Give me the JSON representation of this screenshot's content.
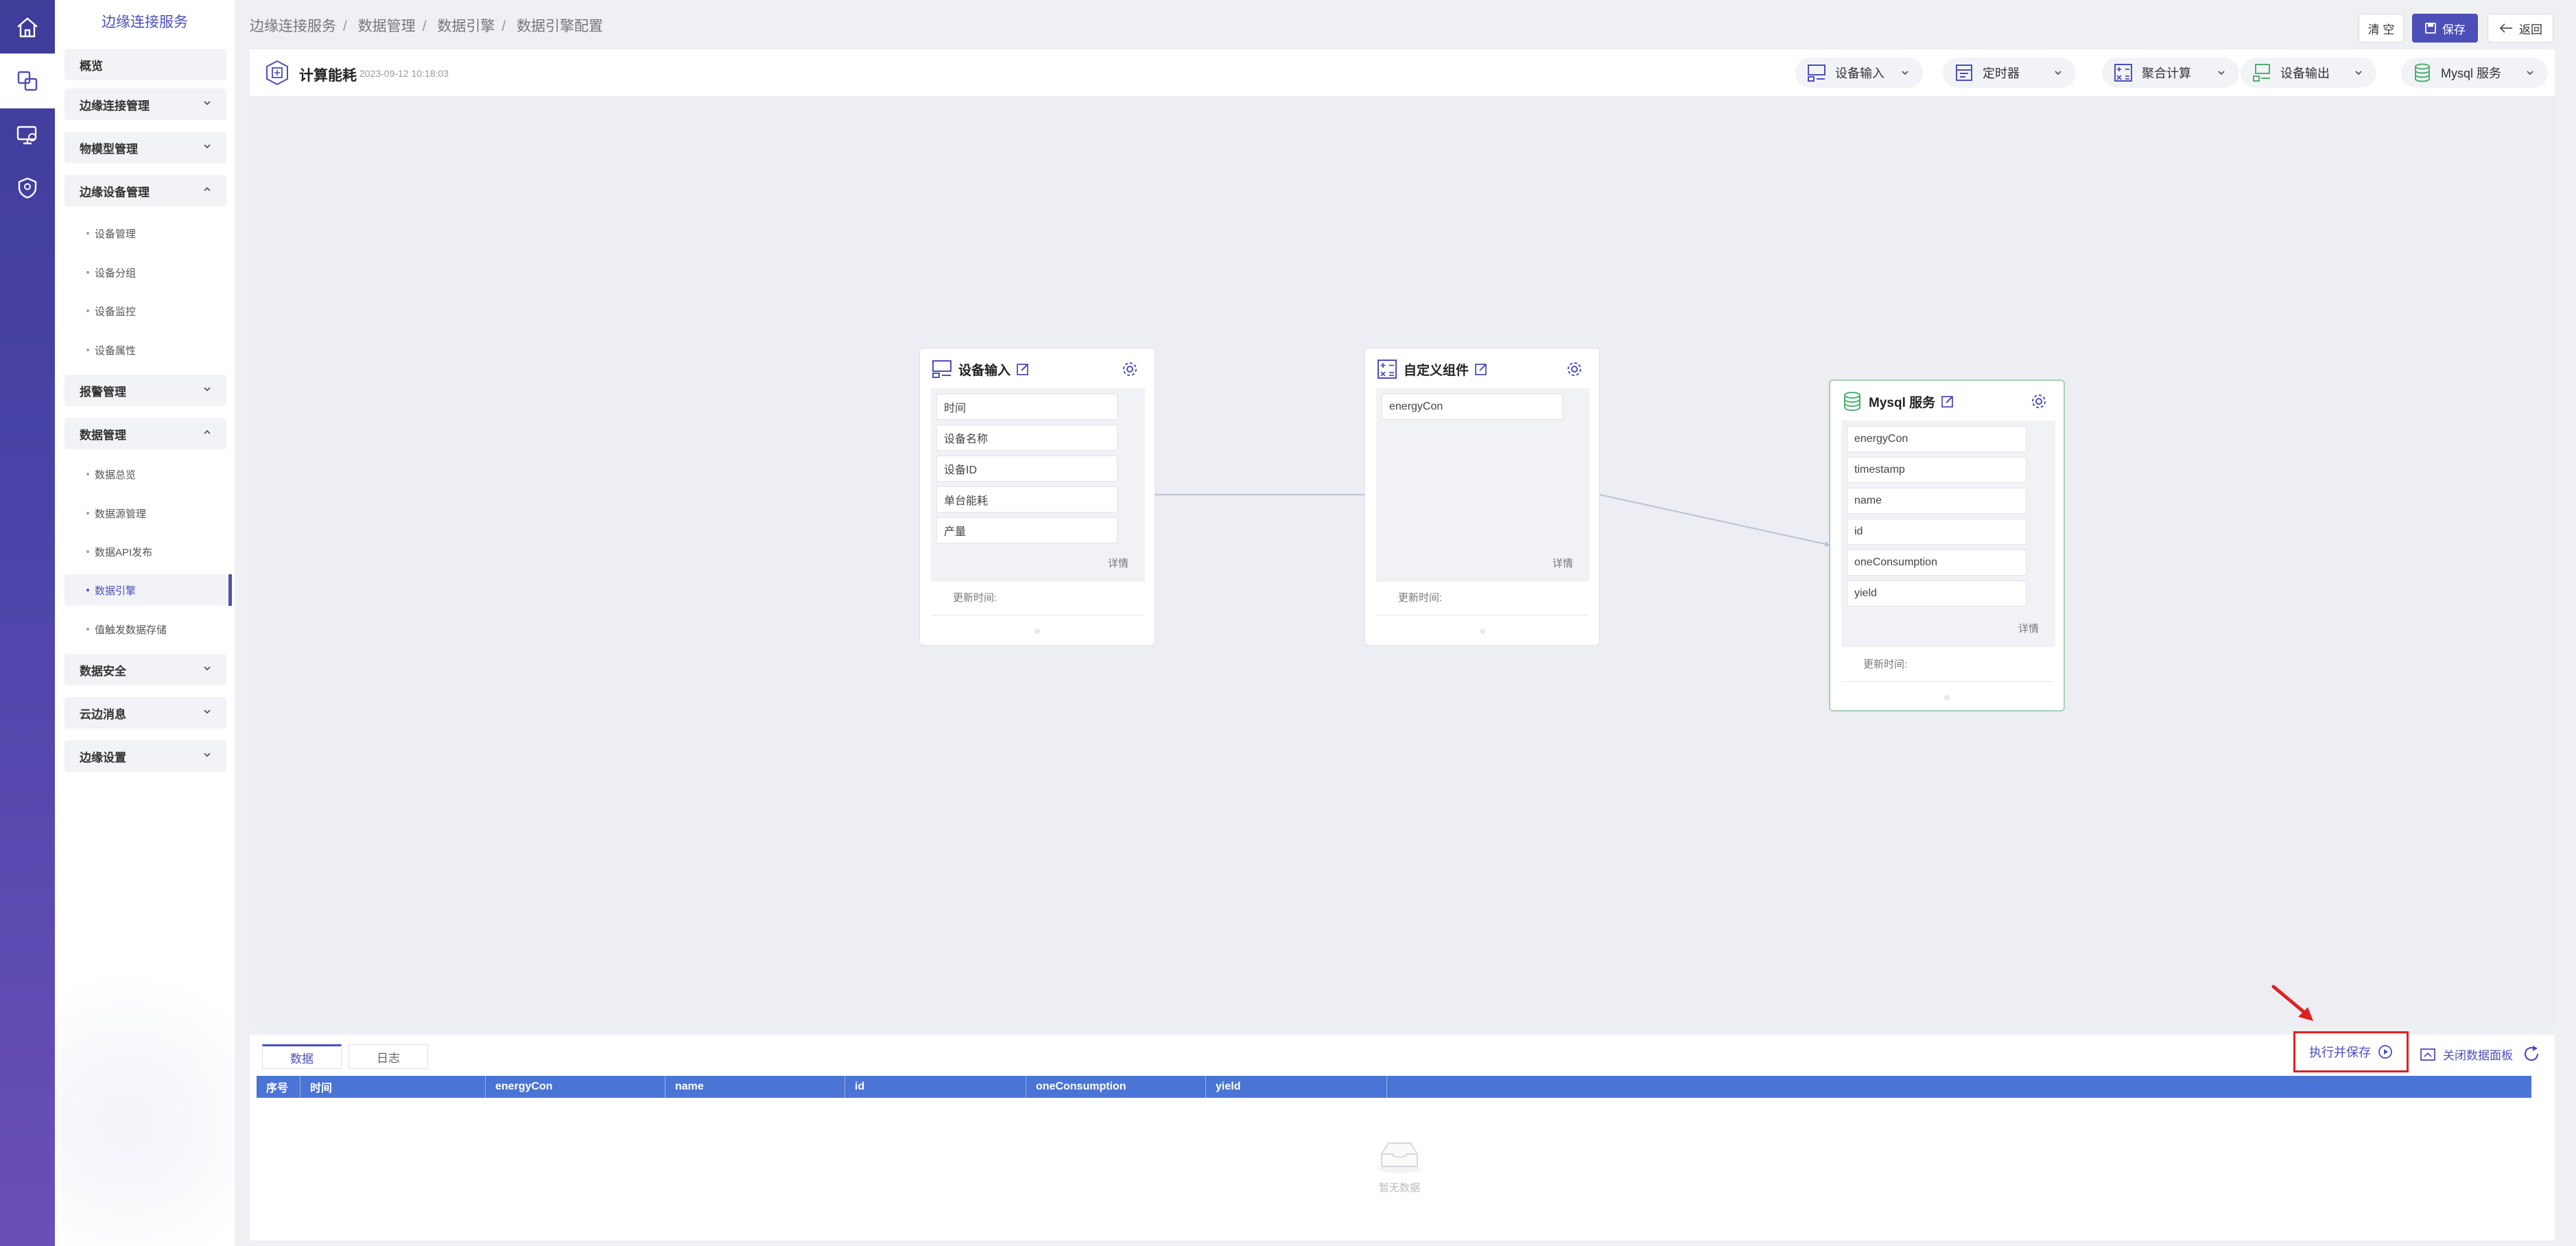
{
  "rail": {
    "items": [
      "home-icon",
      "devices-icon",
      "monitor-icon",
      "security-icon"
    ]
  },
  "sidebar": {
    "title": "边缘连接服务",
    "menu": [
      {
        "label": "概览"
      },
      {
        "label": "边缘连接管理"
      },
      {
        "label": "物模型管理"
      },
      {
        "label": "边缘设备管理"
      },
      {
        "label": "报警管理"
      },
      {
        "label": "数据管理"
      },
      {
        "label": "数据安全"
      },
      {
        "label": "云边消息"
      },
      {
        "label": "边缘设置"
      }
    ],
    "device_sub": [
      "设备管理",
      "设备分组",
      "设备监控",
      "设备属性"
    ],
    "data_sub": [
      "数据总览",
      "数据源管理",
      "数据API发布",
      "数据引擎",
      "值触发数据存储"
    ]
  },
  "breadcrumb": [
    "边缘连接服务",
    "数据管理",
    "数据引擎",
    "数据引擎配置"
  ],
  "toolbar": {
    "clear": "清 空",
    "save": "保存",
    "back": "返回"
  },
  "flow": {
    "title": "计算能耗",
    "time": "2023-09-12 10:18:03"
  },
  "tools": [
    "设备输入",
    "定时器",
    "聚合计算",
    "设备输出",
    "Mysql 服务"
  ],
  "nodes": {
    "input": {
      "title": "设备输入",
      "fields": [
        "时间",
        "设备名称",
        "设备ID",
        "单台能耗",
        "产量"
      ],
      "detail": "详情",
      "update": "更新时间:"
    },
    "custom": {
      "title": "自定义组件",
      "fields": [
        "energyCon"
      ],
      "detail": "详情",
      "update": "更新时间:"
    },
    "mysql": {
      "title": "Mysql 服务",
      "fields": [
        "energyCon",
        "timestamp",
        "name",
        "id",
        "oneConsumption",
        "yield"
      ],
      "detail": "详情",
      "update": "更新时间:"
    }
  },
  "panel": {
    "tabs": [
      "数据",
      "日志"
    ],
    "run_save": "执行并保存",
    "close": "关闭数据面板",
    "columns": [
      "序号",
      "时间",
      "energyCon",
      "name",
      "id",
      "oneConsumption",
      "yield"
    ],
    "empty": "暂无数据"
  },
  "colors": {
    "primary": "#4c4fb8",
    "table_header": "#4a74d6",
    "highlight": "#e02020",
    "node_green": "#a7d3ae"
  }
}
